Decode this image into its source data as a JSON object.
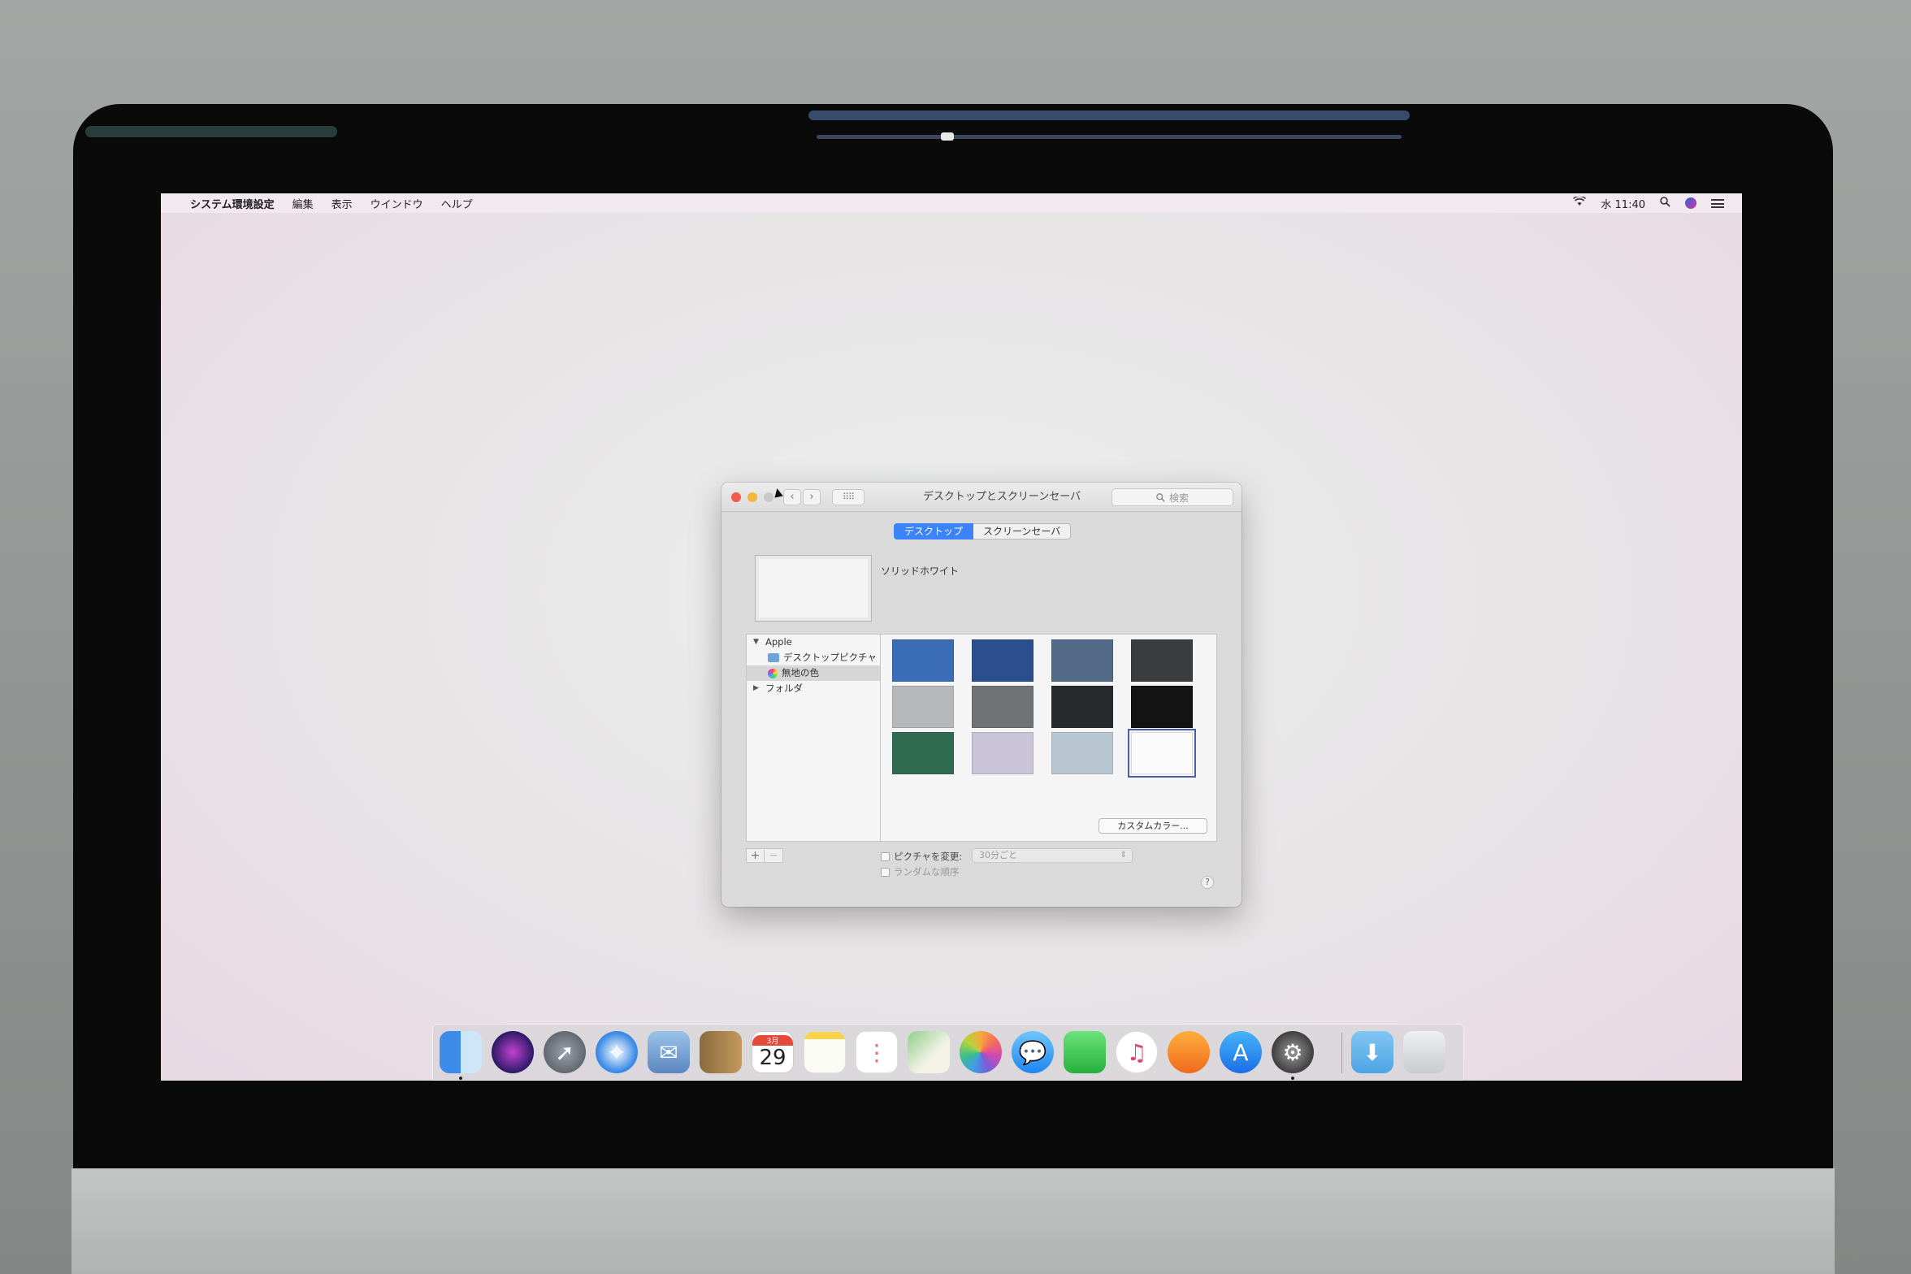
{
  "menubar": {
    "app_name": "システム環境設定",
    "items": [
      "編集",
      "表示",
      "ウインドウ",
      "ヘルプ"
    ],
    "clock": "水 11:40"
  },
  "window": {
    "title": "デスクトップとスクリーンセーバ",
    "search_placeholder": "検索",
    "tabs": [
      {
        "label": "デスクトップ",
        "active": true
      },
      {
        "label": "スクリーンセーバ",
        "active": false
      }
    ],
    "preview_name": "ソリッドホワイト",
    "sidebar": {
      "group": "Apple",
      "children": [
        "デスクトップピクチャ",
        "無地の色"
      ],
      "folder": "フォルダ"
    },
    "swatches": [
      {
        "color": "#3a6db5"
      },
      {
        "color": "#2b4f8e"
      },
      {
        "color": "#536a86"
      },
      {
        "color": "#3b3c3e"
      },
      {
        "color": "#b6b8b9"
      },
      {
        "color": "#707274"
      },
      {
        "color": "#28292b"
      },
      {
        "color": "#131314"
      },
      {
        "color": "#2f6b51"
      },
      {
        "color": "#c9c4d8"
      },
      {
        "color": "#b8c6d2"
      },
      {
        "color": "#fafafa",
        "selected": true
      }
    ],
    "custom_color_button": "カスタムカラー...",
    "change_picture_label": "ピクチャを変更:",
    "interval_value": "30分ごと",
    "random_order_label": "ランダムな順序",
    "add_button": "+",
    "remove_button": "−",
    "help_button": "?"
  },
  "dock": {
    "calendar_month": "3月",
    "calendar_day": "29"
  }
}
